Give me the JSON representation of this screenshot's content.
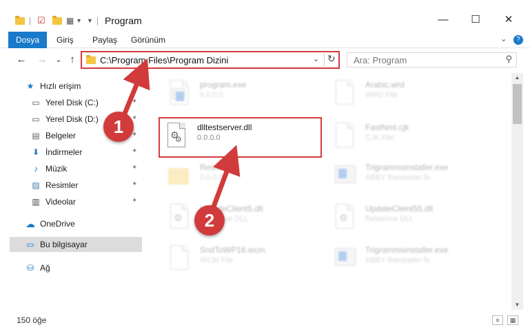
{
  "window": {
    "title": "Program",
    "minimize_glyph": "—",
    "maximize_glyph": "☐",
    "close_glyph": "✕"
  },
  "ribbon": {
    "tabs": [
      "Dosya",
      "Giriş",
      "Paylaş",
      "Görünüm"
    ],
    "expand_glyph": "⌄",
    "help_glyph": "?"
  },
  "nav": {
    "back_glyph": "←",
    "forward_glyph": "→",
    "recent_glyph": "⌄",
    "up_glyph": "↑"
  },
  "address": {
    "path": "C:\\Program Files\\Program Dizini",
    "dropdown_glyph": "⌄",
    "refresh_glyph": "↻"
  },
  "search": {
    "placeholder": "Ara: Program",
    "icon_glyph": "⚲"
  },
  "sidebar": {
    "items": [
      {
        "label": "Hızlı erişim",
        "icon": "star-icon",
        "glyph": "★"
      },
      {
        "label": "Yerel Disk (C:)",
        "icon": "drive-icon",
        "glyph": "▭"
      },
      {
        "label": "Yerel Disk (D:)",
        "icon": "drive-icon",
        "glyph": "▭"
      },
      {
        "label": "Belgeler",
        "icon": "documents-icon",
        "glyph": "▤"
      },
      {
        "label": "İndirmeler",
        "icon": "download-icon",
        "glyph": "⬇"
      },
      {
        "label": "Müzik",
        "icon": "music-icon",
        "glyph": "♪"
      },
      {
        "label": "Resimler",
        "icon": "pictures-icon",
        "glyph": "▨"
      },
      {
        "label": "Videolar",
        "icon": "videos-icon",
        "glyph": "▥"
      },
      {
        "label": "OneDrive",
        "icon": "cloud-icon",
        "glyph": "☁"
      },
      {
        "label": "Bu bilgisayar",
        "icon": "computer-icon",
        "glyph": "▭"
      },
      {
        "label": "Ağ",
        "icon": "network-icon",
        "glyph": "⛁"
      }
    ],
    "pin_glyph": "📌"
  },
  "files": [
    {
      "name": "program.exe",
      "sub": "0.0.0.0",
      "icon": "exe-icon"
    },
    {
      "name": "Arabic.wrd",
      "sub": "WRD File",
      "icon": "file-icon"
    },
    {
      "name": "dlltestserver.dll",
      "sub": "0.0.0.0",
      "icon": "dll-gear-icon"
    },
    {
      "name": "FastNmt.cjk",
      "sub": "CJK File",
      "icon": "file-icon"
    },
    {
      "name": "Resources",
      "sub": "0.0.0.0",
      "icon": "folder-icon"
    },
    {
      "name": "Trigrammsinstaller.exe",
      "sub": "ABBY finereader fo",
      "icon": "app-icon"
    },
    {
      "name": "UpdateClient5.dll",
      "sub": "Resource DLL",
      "icon": "dll-gear-icon"
    },
    {
      "name": "UpdateClient55.dll",
      "sub": "Resource DLL",
      "icon": "dll-gear-icon"
    },
    {
      "name": "SndToWP16.wcm",
      "sub": "WCM File",
      "icon": "file-icon"
    },
    {
      "name": "Trigrammsinstaller.exe",
      "sub": "ABBY finereader fo",
      "icon": "app-icon"
    }
  ],
  "status": {
    "count": "150 öğe"
  },
  "annotations": {
    "badge1": "1",
    "badge2": "2",
    "color": "#d23b3b"
  },
  "colors": {
    "accent": "#1979ca",
    "highlight_red": "#d23b3b"
  }
}
